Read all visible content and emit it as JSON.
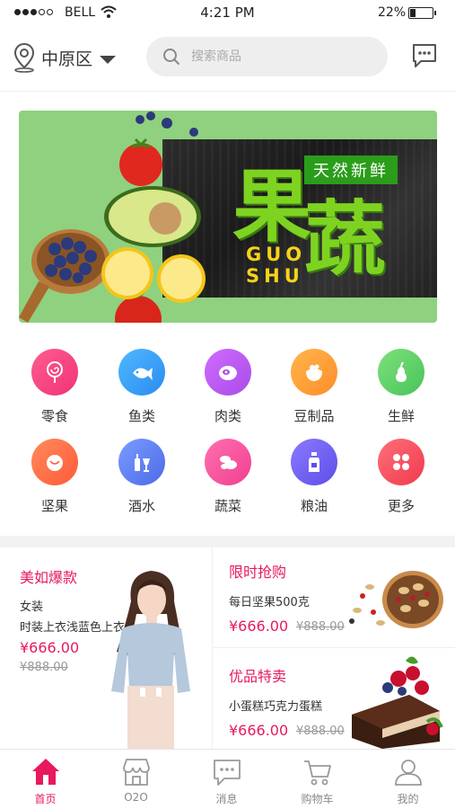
{
  "status_bar": {
    "carrier": "BELL",
    "time": "4:21 PM",
    "battery": "22%",
    "battery_level": 0.22
  },
  "header": {
    "location": "中原区",
    "search_placeholder": "搜索商品"
  },
  "banner": {
    "tag": "天然新鲜",
    "char_1": "果",
    "char_2": "蔬",
    "pinyin_1": "GUO",
    "pinyin_2": "SHU"
  },
  "categories": [
    {
      "label": "零食",
      "icon": "lollipop-icon",
      "color_from": "#ff5c8d",
      "color_to": "#f0337a"
    },
    {
      "label": "鱼类",
      "icon": "fish-icon",
      "color_from": "#4fb8ff",
      "color_to": "#2a8cf0"
    },
    {
      "label": "肉类",
      "icon": "meat-icon",
      "color_from": "#d06bff",
      "color_to": "#a94ce8"
    },
    {
      "label": "豆制品",
      "icon": "tofu-icon",
      "color_from": "#ffb64a",
      "color_to": "#ff8d2a"
    },
    {
      "label": "生鲜",
      "icon": "pear-icon",
      "color_from": "#7ee07a",
      "color_to": "#48c45a"
    },
    {
      "label": "坚果",
      "icon": "nut-icon",
      "color_from": "#ff8a5a",
      "color_to": "#ff5a3a"
    },
    {
      "label": "酒水",
      "icon": "drinks-icon",
      "color_from": "#7a9cff",
      "color_to": "#4c6ae8"
    },
    {
      "label": "蔬菜",
      "icon": "vegetable-icon",
      "color_from": "#ff6fb0",
      "color_to": "#f0408f"
    },
    {
      "label": "粮油",
      "icon": "oil-bottle-icon",
      "color_from": "#8a7aff",
      "color_to": "#5e4ee8"
    },
    {
      "label": "更多",
      "icon": "more-grid-icon",
      "color_from": "#ff6f7a",
      "color_to": "#f03a4c"
    }
  ],
  "promos": {
    "left": {
      "title": "美如爆款",
      "sub1": "女装",
      "sub2": "时装上衣浅蓝色上衣",
      "price": "¥666.00",
      "old_price": "¥888.00"
    },
    "flash": {
      "title": "限时抢购",
      "sub": "每日坚果500克",
      "price": "¥666.00",
      "old_price": "¥888.00"
    },
    "special": {
      "title": "优品特卖",
      "sub": "小蛋糕巧克力蛋糕",
      "price": "¥666.00",
      "old_price": "¥888.00"
    }
  },
  "tabs": [
    {
      "label": "首页",
      "icon": "home-icon",
      "active": true
    },
    {
      "label": "O2O",
      "icon": "store-icon",
      "active": false
    },
    {
      "label": "消息",
      "icon": "message-icon",
      "active": false
    },
    {
      "label": "购物车",
      "icon": "cart-icon",
      "active": false
    },
    {
      "label": "我的",
      "icon": "profile-icon",
      "active": false
    }
  ],
  "colors": {
    "accent": "#e8195c",
    "banner_green": "#8fd17f",
    "tag_green": "#2b9d1b"
  }
}
